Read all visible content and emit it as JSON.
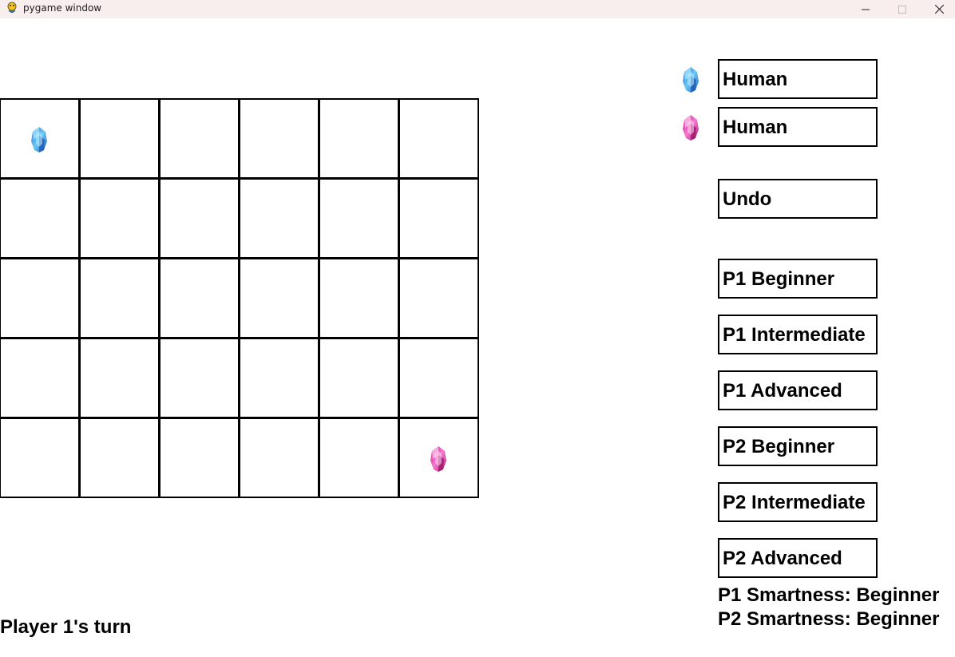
{
  "window": {
    "title": "pygame window",
    "app_icon": "pygame-snake-icon",
    "controls": [
      "minimize-icon",
      "maximize-icon",
      "close-icon"
    ]
  },
  "board": {
    "rows": 5,
    "cols": 6,
    "pieces": [
      {
        "player": 1,
        "row": 0,
        "col": 0,
        "color": "#4aa8e8",
        "icon": "blue-gem-icon"
      },
      {
        "player": 2,
        "row": 4,
        "col": 5,
        "color": "#e83fa8",
        "icon": "pink-gem-icon"
      }
    ]
  },
  "side_panel": {
    "player1_type": "Human",
    "player2_type": "Human",
    "player1_icon": "blue-gem-icon",
    "player2_icon": "pink-gem-icon",
    "undo_label": "Undo",
    "p1_beginner": "P1 Beginner",
    "p1_intermediate": "P1 Intermediate",
    "p1_advanced": "P1 Advanced",
    "p2_beginner": "P2 Beginner",
    "p2_intermediate": "P2 Intermediate",
    "p2_advanced": "P2 Advanced",
    "p1_smartness": "P1 Smartness: Beginner",
    "p2_smartness": "P2 Smartness: Beginner"
  },
  "status": {
    "turn_text": "Player 1's turn"
  }
}
